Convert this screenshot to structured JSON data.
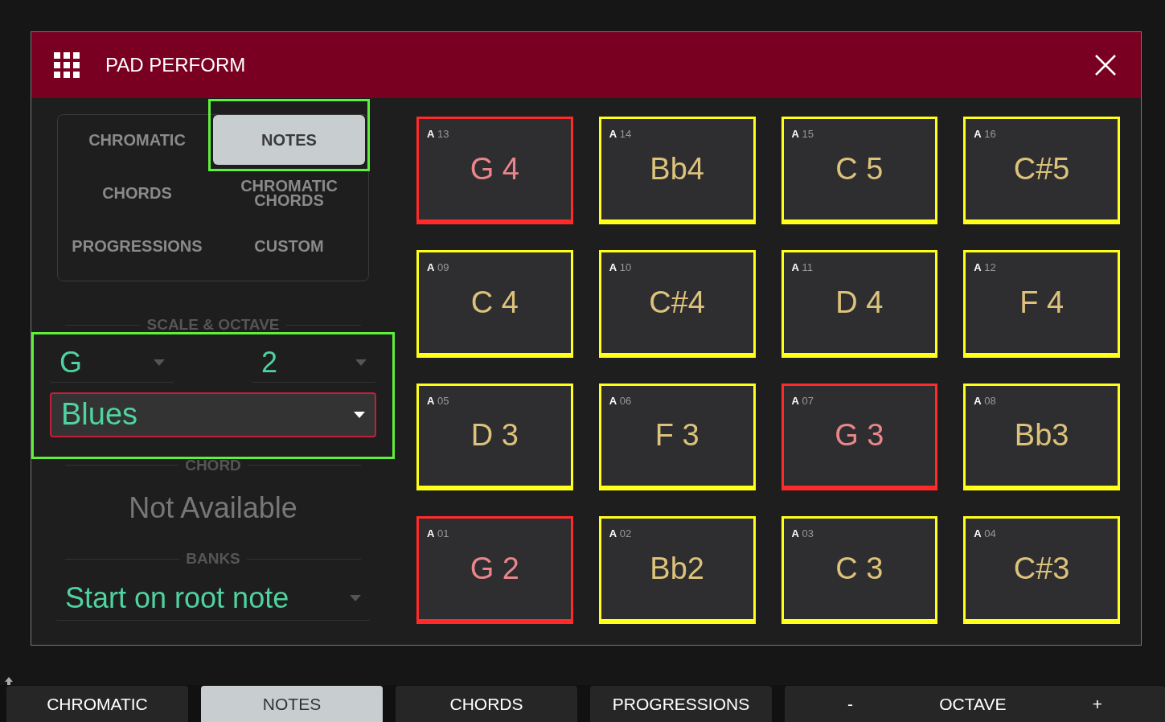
{
  "dialog": {
    "title": "PAD PERFORM"
  },
  "modes": [
    {
      "label": "CHROMATIC",
      "selected": false,
      "highlighted": false
    },
    {
      "label": "NOTES",
      "selected": true,
      "highlighted": true
    },
    {
      "label": "CHORDS",
      "selected": false,
      "highlighted": false
    },
    {
      "label": "CHROMATIC\nCHORDS",
      "selected": false,
      "highlighted": false
    },
    {
      "label": "PROGRESSIONS",
      "selected": false,
      "highlighted": false
    },
    {
      "label": "CUSTOM",
      "selected": false,
      "highlighted": false
    }
  ],
  "scale_octave": {
    "title": "SCALE & OCTAVE",
    "highlighted": true,
    "root": "G",
    "octave": "2",
    "scale": "Blues",
    "scale_focused": true
  },
  "chord": {
    "title": "CHORD",
    "value": "Not Available"
  },
  "banks": {
    "title": "BANKS",
    "value": "Start on root note"
  },
  "pads": [
    {
      "bank": "A",
      "number": "13",
      "note": "G 4",
      "color": "#ff2a2a"
    },
    {
      "bank": "A",
      "number": "14",
      "note": "Bb4",
      "color": "#ffff1a"
    },
    {
      "bank": "A",
      "number": "15",
      "note": "C 5",
      "color": "#ffff1a"
    },
    {
      "bank": "A",
      "number": "16",
      "note": "C#5",
      "color": "#ffff1a"
    },
    {
      "bank": "A",
      "number": "09",
      "note": "C 4",
      "color": "#ffff1a"
    },
    {
      "bank": "A",
      "number": "10",
      "note": "C#4",
      "color": "#ffff1a"
    },
    {
      "bank": "A",
      "number": "11",
      "note": "D 4",
      "color": "#ffff1a"
    },
    {
      "bank": "A",
      "number": "12",
      "note": "F 4",
      "color": "#ffff1a"
    },
    {
      "bank": "A",
      "number": "05",
      "note": "D 3",
      "color": "#ffff1a"
    },
    {
      "bank": "A",
      "number": "06",
      "note": "F 3",
      "color": "#ffff1a"
    },
    {
      "bank": "A",
      "number": "07",
      "note": "G 3",
      "color": "#ff2a2a"
    },
    {
      "bank": "A",
      "number": "08",
      "note": "Bb3",
      "color": "#ffff1a"
    },
    {
      "bank": "A",
      "number": "01",
      "note": "G 2",
      "color": "#ff2a2a"
    },
    {
      "bank": "A",
      "number": "02",
      "note": "Bb2",
      "color": "#ffff1a"
    },
    {
      "bank": "A",
      "number": "03",
      "note": "C 3",
      "color": "#ffff1a"
    },
    {
      "bank": "A",
      "number": "04",
      "note": "C#3",
      "color": "#ffff1a"
    }
  ],
  "bottom_bar": [
    {
      "label": "CHROMATIC",
      "selected": false
    },
    {
      "label": "NOTES",
      "selected": true
    },
    {
      "label": "CHORDS",
      "selected": false
    },
    {
      "label": "PROGRESSIONS",
      "selected": false
    }
  ],
  "octave": {
    "minus": "-",
    "label": "OCTAVE",
    "plus": "+"
  }
}
